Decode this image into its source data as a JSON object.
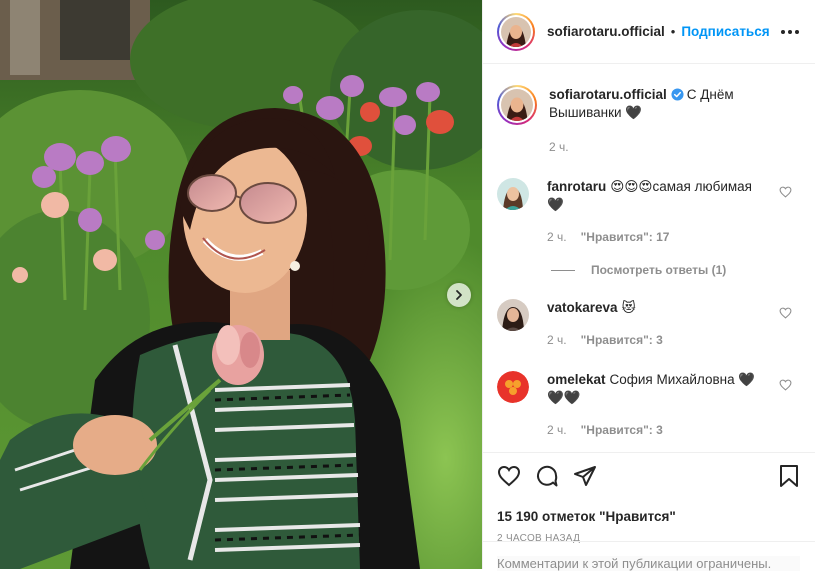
{
  "post": {
    "username": "sofiarotaru.official",
    "separator": "•",
    "follow_label": "Подписаться",
    "caption": "С Днём Вышиванки 🖤",
    "caption_time": "2 ч.",
    "verified_icon": "verified-badge-icon"
  },
  "comments": [
    {
      "user": "fanrotaru",
      "text": "😍😍😍самая любимая 🖤",
      "time": "2 ч.",
      "likes": "\"Нравится\": 17",
      "replies": "Посмотреть ответы (1)"
    },
    {
      "user": "vatokareva",
      "text": "😻",
      "time": "2 ч.",
      "likes": "\"Нравится\": 3"
    },
    {
      "user": "omelekat",
      "text": "София Михайловна 🖤🖤🖤",
      "time": "2 ч.",
      "likes": "\"Нравится\": 3"
    }
  ],
  "actions": {
    "likes_count": "15 190 отметок \"Нравится\"",
    "time_ago": "2 часов назад",
    "comment_placeholder": "Комментарии к этой публикации ограничены."
  },
  "colors": {
    "accent": "#0095f6",
    "text": "#262626",
    "muted": "#8e8e8e",
    "border": "#efefef"
  }
}
